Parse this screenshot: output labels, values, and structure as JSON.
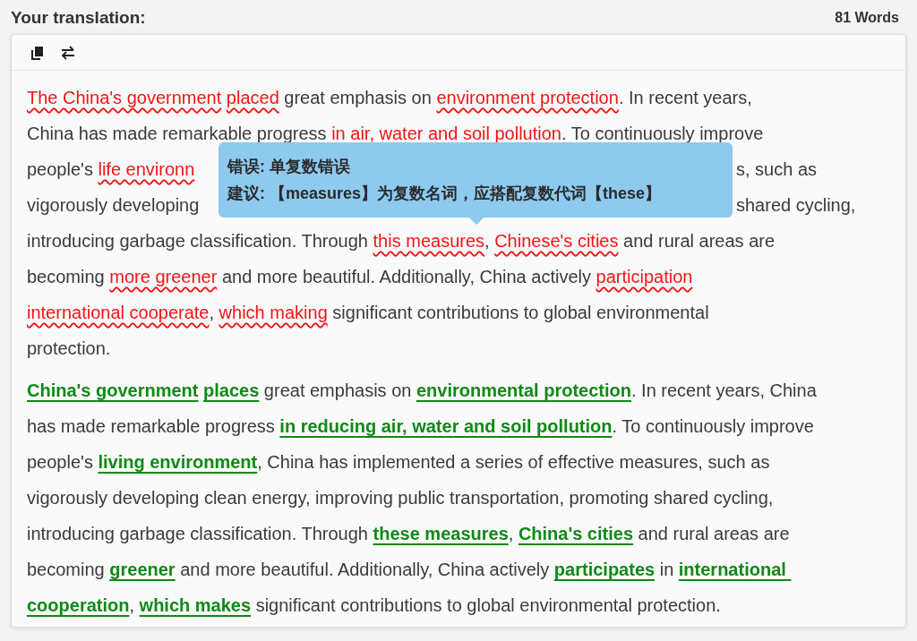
{
  "header": {
    "title": "Your translation:",
    "word_count": "81 Words"
  },
  "toolbar": [
    {
      "kind": "copy"
    },
    {
      "kind": "swap"
    }
  ],
  "paragraphs": [
    {
      "kind": "original",
      "lines": [
        [
          {
            "kind": "mark",
            "text": "The China's government"
          },
          {
            "kind": "mark",
            "text": "placed"
          },
          {
            "kind": "text",
            "text": " great emphasis on "
          },
          {
            "kind": "mark",
            "text": "environment protection"
          },
          {
            "kind": "text",
            "text": ". In recent years,"
          }
        ],
        [
          {
            "kind": "text",
            "text": "China has made remarkable progress "
          },
          {
            "kind": "mark",
            "text": "in air, water and soil pollution"
          },
          {
            "kind": "text",
            "text": ". To continuously improve"
          }
        ],
        [
          {
            "kind": "text",
            "text": "people's "
          },
          {
            "kind": "mark",
            "text": "life environn"
          },
          {
            "kind": "covered"
          },
          {
            "kind": "text",
            "text": "s, such as"
          }
        ],
        [
          {
            "kind": "text",
            "text": "vigorously developing"
          },
          {
            "kind": "covered"
          },
          {
            "kind": "text",
            "text": "shared cycling,"
          }
        ],
        [
          {
            "kind": "text",
            "text": "introducing garbage classification. Through "
          },
          {
            "kind": "mark",
            "text": "this measures"
          },
          {
            "kind": "text",
            "text": ", "
          },
          {
            "kind": "mark",
            "text": "Chinese's cities"
          },
          {
            "kind": "text",
            "text": " and rural areas are"
          }
        ],
        [
          {
            "kind": "text",
            "text": "becoming "
          },
          {
            "kind": "mark",
            "text": "more greener"
          },
          {
            "kind": "text",
            "text": " and more beautiful. Additionally, China actively "
          },
          {
            "kind": "mark",
            "text": "participation"
          }
        ],
        [
          {
            "kind": "mark",
            "text": "international cooperate"
          },
          {
            "kind": "text",
            "text": ", "
          },
          {
            "kind": "mark",
            "text": "which making"
          },
          {
            "kind": "text",
            "text": " significant contributions to global environmental"
          }
        ],
        [
          {
            "kind": "text",
            "text": "protection."
          }
        ]
      ]
    },
    {
      "kind": "corrected",
      "lines": [
        [
          {
            "kind": "mark",
            "text": "China's government"
          },
          {
            "kind": "mark",
            "text": "places"
          },
          {
            "kind": "text",
            "text": " great emphasis on "
          },
          {
            "kind": "mark",
            "text": "environmental protection"
          },
          {
            "kind": "text",
            "text": ". In recent years, China"
          }
        ],
        [
          {
            "kind": "text",
            "text": "has made remarkable progress "
          },
          {
            "kind": "mark",
            "text": "in reducing air, water and soil pollution"
          },
          {
            "kind": "text",
            "text": ". To continuously improve"
          }
        ],
        [
          {
            "kind": "text",
            "text": "people's "
          },
          {
            "kind": "mark",
            "text": "living environment"
          },
          {
            "kind": "text",
            "text": ", China has implemented a series of effective measures, such as"
          }
        ],
        [
          {
            "kind": "text",
            "text": "vigorously developing clean energy, improving public transportation, promoting shared cycling,"
          }
        ],
        [
          {
            "kind": "text",
            "text": "introducing garbage classification. Through "
          },
          {
            "kind": "mark",
            "text": "these measures"
          },
          {
            "kind": "text",
            "text": ", "
          },
          {
            "kind": "mark",
            "text": "China's cities"
          },
          {
            "kind": "text",
            "text": " and rural areas are"
          }
        ],
        [
          {
            "kind": "text",
            "text": "becoming "
          },
          {
            "kind": "mark",
            "text": "greener"
          },
          {
            "kind": "text",
            "text": " and more beautiful. Additionally, China actively "
          },
          {
            "kind": "mark",
            "text": "participates"
          },
          {
            "kind": "text",
            "text": " in "
          },
          {
            "kind": "mark",
            "text": "international "
          }
        ],
        [
          {
            "kind": "mark",
            "text": "cooperation"
          },
          {
            "kind": "text",
            "text": ", "
          },
          {
            "kind": "mark",
            "text": "which makes"
          },
          {
            "kind": "text",
            "text": " significant contributions to global environmental protection."
          }
        ]
      ]
    }
  ],
  "tooltip": {
    "error": "错误: 单复数错误",
    "suggestion": "建议: 【measures】为复数名词，应搭配复数代词【these】"
  }
}
